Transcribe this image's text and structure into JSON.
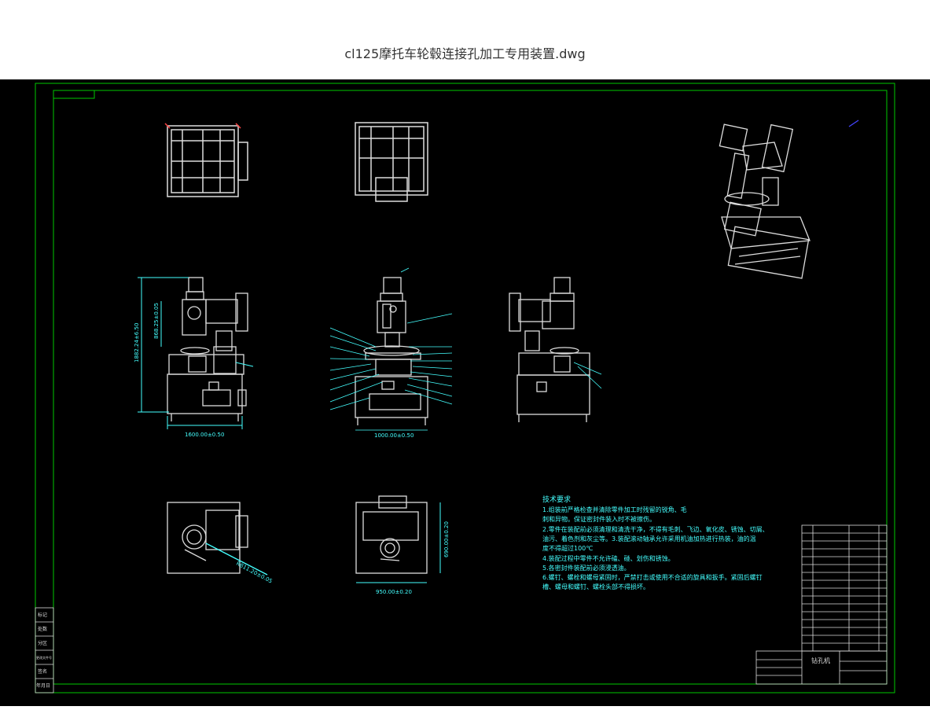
{
  "window": {
    "file_title": "cl125摩托车轮毂连接孔加工专用装置.dwg"
  },
  "drawing": {
    "dimensions": {
      "height_left": "1882.24±6.50",
      "height_left2": "868.25±0.05",
      "width_left": "1600.00±0.50",
      "width_mid": "1000.00±0.50",
      "plan_diag": "R811.20±0.05",
      "plan_width": "950.00±0.20",
      "plan_height": "690.00±0.20"
    },
    "technical_requirements": {
      "title": "技术要求",
      "lines": [
        "1.组装前严格检查并清除零件加工时残留的锐角、毛",
        "刺和异物。保证密封件装入时不被擦伤。",
        "2.零件在装配前必须清理和清洗干净，不得有毛刺、飞边、氧化皮、锈蚀、切屑、",
        "油污、着色剂和灰尘等。3.装配滚动轴承允许采用机油加热进行热装，油的温",
        "度不得超过100℃",
        "4.装配过程中零件不允许磕、碰、划伤和锈蚀。",
        "5.各密封件装配前必须浸透油。",
        "6.螺钉、螺栓和螺母紧固时，严禁打击或使用不合适的旋具和扳手。紧固后螺钉",
        "槽、螺母和螺钉、螺栓头部不得损坏。"
      ]
    },
    "title_block": {
      "name": "钻孔机"
    },
    "left_block_labels": [
      "标记",
      "处数",
      "分区",
      "更改文件号",
      "签名",
      "年月日"
    ]
  }
}
